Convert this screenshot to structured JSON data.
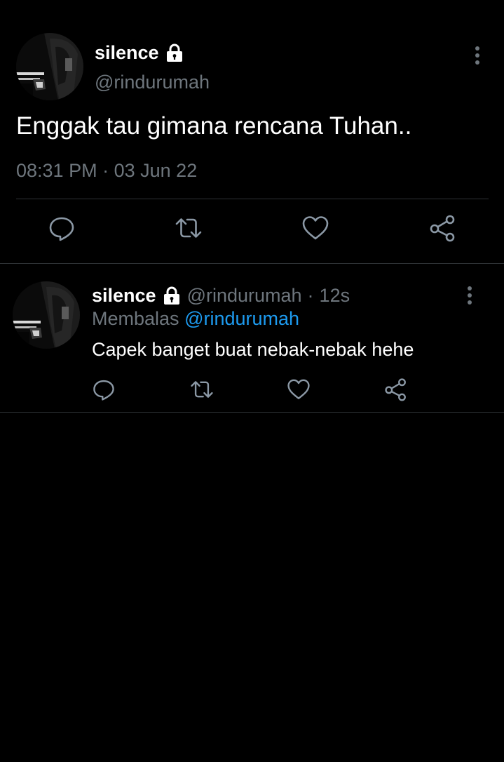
{
  "colors": {
    "background": "#000000",
    "text_primary": "#ffffff",
    "text_secondary": "#6e767d",
    "link": "#1d9bf0",
    "divider": "#2f3336"
  },
  "main_tweet": {
    "author": {
      "display_name": "silence",
      "handle": "@rindurumah",
      "protected_icon": "lock-icon",
      "avatar_icon": "avatar"
    },
    "text": "Enggak tau gimana rencana Tuhan..",
    "time": "08:31 PM",
    "meta_separator": "·",
    "date": "03 Jun 22",
    "more_icon": "more-vertical-icon",
    "actions": [
      "reply-icon",
      "retweet-icon",
      "like-icon",
      "share-icon"
    ]
  },
  "reply_tweet": {
    "author": {
      "display_name": "silence",
      "handle": "@rindurumah",
      "protected_icon": "lock-icon",
      "avatar_icon": "avatar"
    },
    "separator": "·",
    "time_ago": "12s",
    "replying_to_label": "Membalas",
    "replying_to_handle": "@rindurumah",
    "text": "Capek banget buat nebak-nebak hehe",
    "more_icon": "more-vertical-icon",
    "actions": [
      "reply-icon",
      "retweet-icon",
      "like-icon",
      "share-icon"
    ]
  }
}
